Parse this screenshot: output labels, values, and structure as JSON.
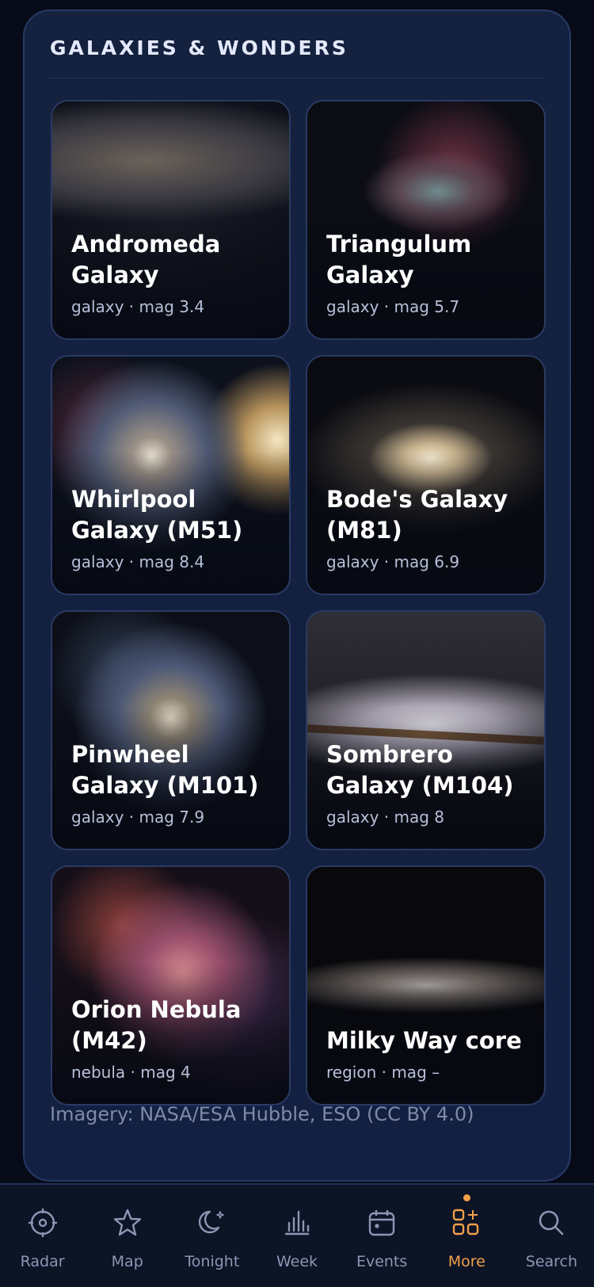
{
  "panel": {
    "title": "GALAXIES & WONDERS"
  },
  "cards": [
    {
      "name": "Andromeda Galaxy",
      "meta": "galaxy · mag 3.4"
    },
    {
      "name": "Triangulum Galaxy",
      "meta": "galaxy · mag 5.7"
    },
    {
      "name": "Whirlpool Galaxy (M51)",
      "meta": "galaxy · mag 8.4"
    },
    {
      "name": "Bode's Galaxy (M81)",
      "meta": "galaxy · mag 6.9"
    },
    {
      "name": "Pinwheel Galaxy (M101)",
      "meta": "galaxy · mag 7.9"
    },
    {
      "name": "Sombrero Galaxy (M104)",
      "meta": "galaxy · mag 8"
    },
    {
      "name": "Orion Nebula (M42)",
      "meta": "nebula · mag 4"
    },
    {
      "name": "Milky Way core",
      "meta": "region · mag –"
    }
  ],
  "credit": "Imagery: NASA/ESA Hubble, ESO (CC BY 4.0)",
  "nav": [
    {
      "label": "Radar",
      "icon": "radar-icon"
    },
    {
      "label": "Map",
      "icon": "star-icon"
    },
    {
      "label": "Tonight",
      "icon": "moon-icon"
    },
    {
      "label": "Week",
      "icon": "bar-chart-icon"
    },
    {
      "label": "Events",
      "icon": "calendar-icon"
    },
    {
      "label": "More",
      "icon": "grid-sparkle-icon",
      "active": true
    },
    {
      "label": "Search",
      "icon": "search-icon"
    }
  ],
  "colors": {
    "accent": "#f2a04a",
    "panel": "#14213f",
    "background": "#070b17"
  }
}
